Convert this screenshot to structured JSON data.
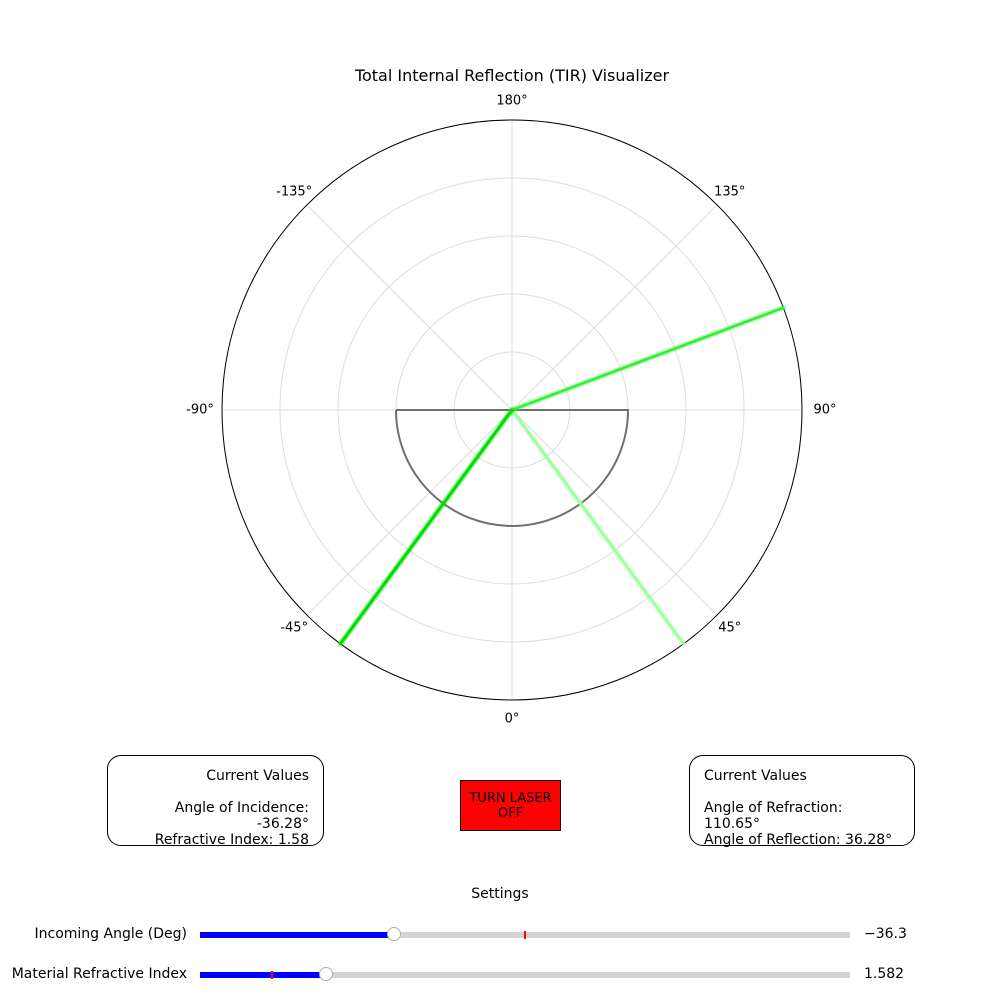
{
  "title": "Total Internal Reflection (TIR) Visualizer",
  "polar": {
    "angle_labels": [
      "180°",
      "135°",
      "90°",
      "45°",
      "0°",
      "-45°",
      "-90°",
      "-135°"
    ],
    "angle_values": [
      180,
      135,
      90,
      45,
      0,
      -45,
      -90,
      -135
    ],
    "rings": 5,
    "incident_ray_angle_deg": -36.28,
    "reflected_ray_angle_deg": 36.28,
    "refracted_ray_angle_deg": 110.65,
    "semicircle_radius_fraction": 0.4,
    "colors": {
      "grid": "#dddddd",
      "frame": "#000000",
      "incident": "#00dd00",
      "reflected": "#99ff99",
      "refracted": "#33ee33",
      "semicircle": "#707070"
    }
  },
  "left_panel": {
    "heading": "Current Values",
    "angle_of_incidence": "Angle of Incidence: -36.28°",
    "refractive_index": "Refractive Index: 1.58"
  },
  "right_panel": {
    "heading": "Current Values",
    "angle_of_refraction": "Angle of Refraction: 110.65°",
    "angle_of_reflection": "Angle of Reflection: 36.28°"
  },
  "laser_button": {
    "label_line1": "TURN LASER",
    "label_line2": "OFF",
    "color": "#ff0000"
  },
  "settings": {
    "title": "Settings",
    "sliders": [
      {
        "label": "Incoming Angle (Deg)",
        "value_text": "−36.3",
        "value": -36.28,
        "min": -90,
        "max": 90,
        "marker": 0
      },
      {
        "label": "Material Refractive Index",
        "value_text": "1.582",
        "value": 1.582,
        "min": 1.0,
        "max": 4.0,
        "marker": 1.33
      }
    ]
  }
}
